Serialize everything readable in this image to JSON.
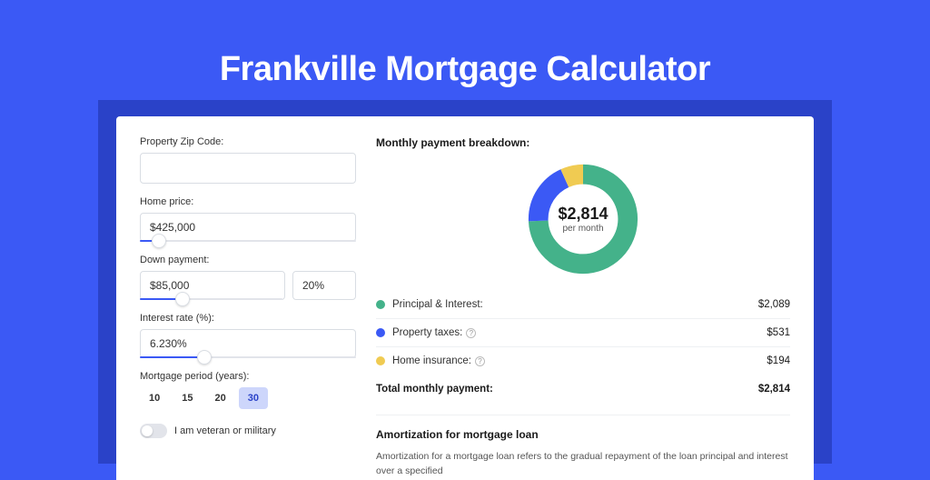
{
  "page_title": "Frankville Mortgage Calculator",
  "inputs": {
    "zip": {
      "label": "Property Zip Code:",
      "value": ""
    },
    "home_price": {
      "label": "Home price:",
      "value": "$425,000",
      "slider_pct": 9
    },
    "down_payment": {
      "label": "Down payment:",
      "value": "$85,000",
      "pct": "20%",
      "slider_pct": 20
    },
    "interest_rate": {
      "label": "Interest rate (%):",
      "value": "6.230%",
      "slider_pct": 30
    },
    "period": {
      "label": "Mortgage period (years):",
      "options": [
        "10",
        "15",
        "20",
        "30"
      ],
      "selected": "30"
    },
    "veteran": {
      "label": "I am veteran or military",
      "on": false
    }
  },
  "breakdown": {
    "title": "Monthly payment breakdown:",
    "center_value": "$2,814",
    "center_label": "per month",
    "items": [
      {
        "label": "Principal & Interest:",
        "value": "$2,089",
        "color": "#44b28a",
        "info": false
      },
      {
        "label": "Property taxes:",
        "value": "$531",
        "color": "#3b59f5",
        "info": true
      },
      {
        "label": "Home insurance:",
        "value": "$194",
        "color": "#f0cb52",
        "info": true
      }
    ],
    "total": {
      "label": "Total monthly payment:",
      "value": "$2,814"
    }
  },
  "amortization": {
    "title": "Amortization for mortgage loan",
    "body": "Amortization for a mortgage loan refers to the gradual repayment of the loan principal and interest over a specified"
  },
  "chart_data": {
    "type": "pie",
    "title": "Monthly payment breakdown",
    "center_value": 2814,
    "center_label": "per month",
    "series": [
      {
        "name": "Principal & Interest",
        "value": 2089,
        "color": "#44b28a"
      },
      {
        "name": "Property taxes",
        "value": 531,
        "color": "#3b59f5"
      },
      {
        "name": "Home insurance",
        "value": 194,
        "color": "#f0cb52"
      }
    ],
    "total": 2814
  }
}
